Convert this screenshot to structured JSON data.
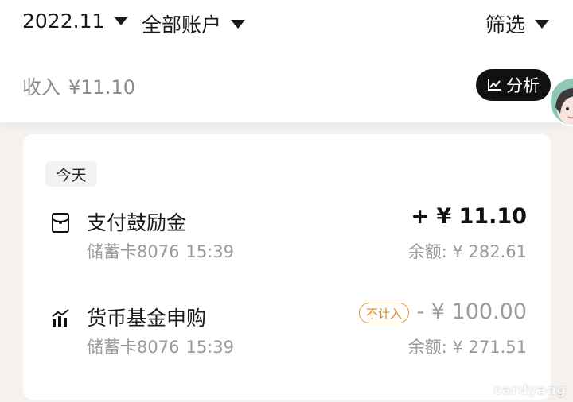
{
  "filters": {
    "month": "2022.11",
    "account": "全部账户",
    "filter": "筛选"
  },
  "summary": {
    "label": "收入",
    "amount": "¥11.10",
    "analysis_label": "分析"
  },
  "day_group": "今天",
  "transactions": [
    {
      "icon": "red-envelope-icon",
      "title": "支付鼓励金",
      "card": "储蓄卡8076",
      "time": "15:39",
      "amount": "+ ¥ 11.10",
      "balance": "余额: ¥ 282.61"
    },
    {
      "icon": "bar-chart-icon",
      "title": "货币基金申购",
      "card": "储蓄卡8076",
      "time": "15:39",
      "tag": "不计入",
      "amount": "- ¥ 100.00",
      "balance": "余额: ¥ 271.51"
    }
  ],
  "watermark": "cardyang",
  "colors": {
    "tag_border": "#e0a040",
    "analysis_bg": "#111111",
    "avatar_bg": "#8fc9b6"
  }
}
